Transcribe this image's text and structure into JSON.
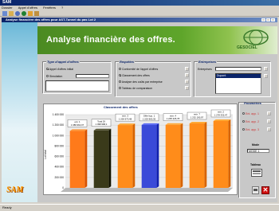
{
  "app": {
    "title": "SAM",
    "menu": [
      "Dossier",
      "Appel d'offres",
      "Fenêtres",
      "?"
    ]
  },
  "document": {
    "title": "Analyse financière des offres pour AST-Tunnel du pas Lot 2"
  },
  "header": {
    "title": "Analyse financière des offres.",
    "logo": "GESOCIEL"
  },
  "type_appel": {
    "label": "Type d'appel d'offres",
    "options": [
      "Appel d'offres initial",
      "Simulation"
    ],
    "selected_index": 0
  },
  "requetes": {
    "label": "Requêtes",
    "options": [
      "Conformité de l'appel d'offres",
      "Classement des offres",
      "Analyse des coûts par entreprise",
      "Tableau de comparaison"
    ],
    "selected_index": 1
  },
  "entreprises": {
    "label": "Entreprises",
    "field_label": "Entreprises",
    "list_item": "Dupont"
  },
  "chart_data": {
    "type": "bar",
    "title": "Classement des offres",
    "ylabel": "Lot total",
    "yticks": [
      "1 400 000",
      "1 200 000",
      "1 000 000",
      "800 000",
      "600 000",
      "400 000",
      "200 000",
      "0"
    ],
    "ylim": [
      0,
      1400000
    ],
    "series": [
      {
        "name": "ent. 1",
        "value": 1089962,
        "color": "#ff7a1a"
      },
      {
        "name": "Total 29",
        "value": 1098968,
        "color": "#3a3a1a"
      },
      {
        "name": "entr. 3",
        "value": 1200573,
        "color": "#ff8c1a"
      },
      {
        "name": "Offre hyp. 1",
        "value": 1203963,
        "color": "#3a4ad8"
      },
      {
        "name": "entr. 4",
        "value": 1205226,
        "color": "#ff8c1a"
      },
      {
        "name": "entr. 7",
        "value": 1232190,
        "color": "#ff8c1a"
      },
      {
        "name": "entr. 2",
        "value": 1278332,
        "color": "#ff8c1a"
      }
    ],
    "data_labels": [
      "1 089 962,07",
      "1 098 968,1",
      "1 200 573,48",
      "1 203 963,35",
      "1 205 226,78",
      "1 232 190,97",
      "1 278 332,47"
    ]
  },
  "parametres": {
    "label": "Paramètres",
    "options": [
      "Ent. app. 1",
      "Ent. app. 2",
      "Ent. app. 3"
    ],
    "mode_label": "Mode",
    "mode_value": "MODE 1",
    "tableau_label": "Tableau"
  },
  "status": {
    "text": "Ready"
  },
  "branding": {
    "sam": "SAM"
  }
}
